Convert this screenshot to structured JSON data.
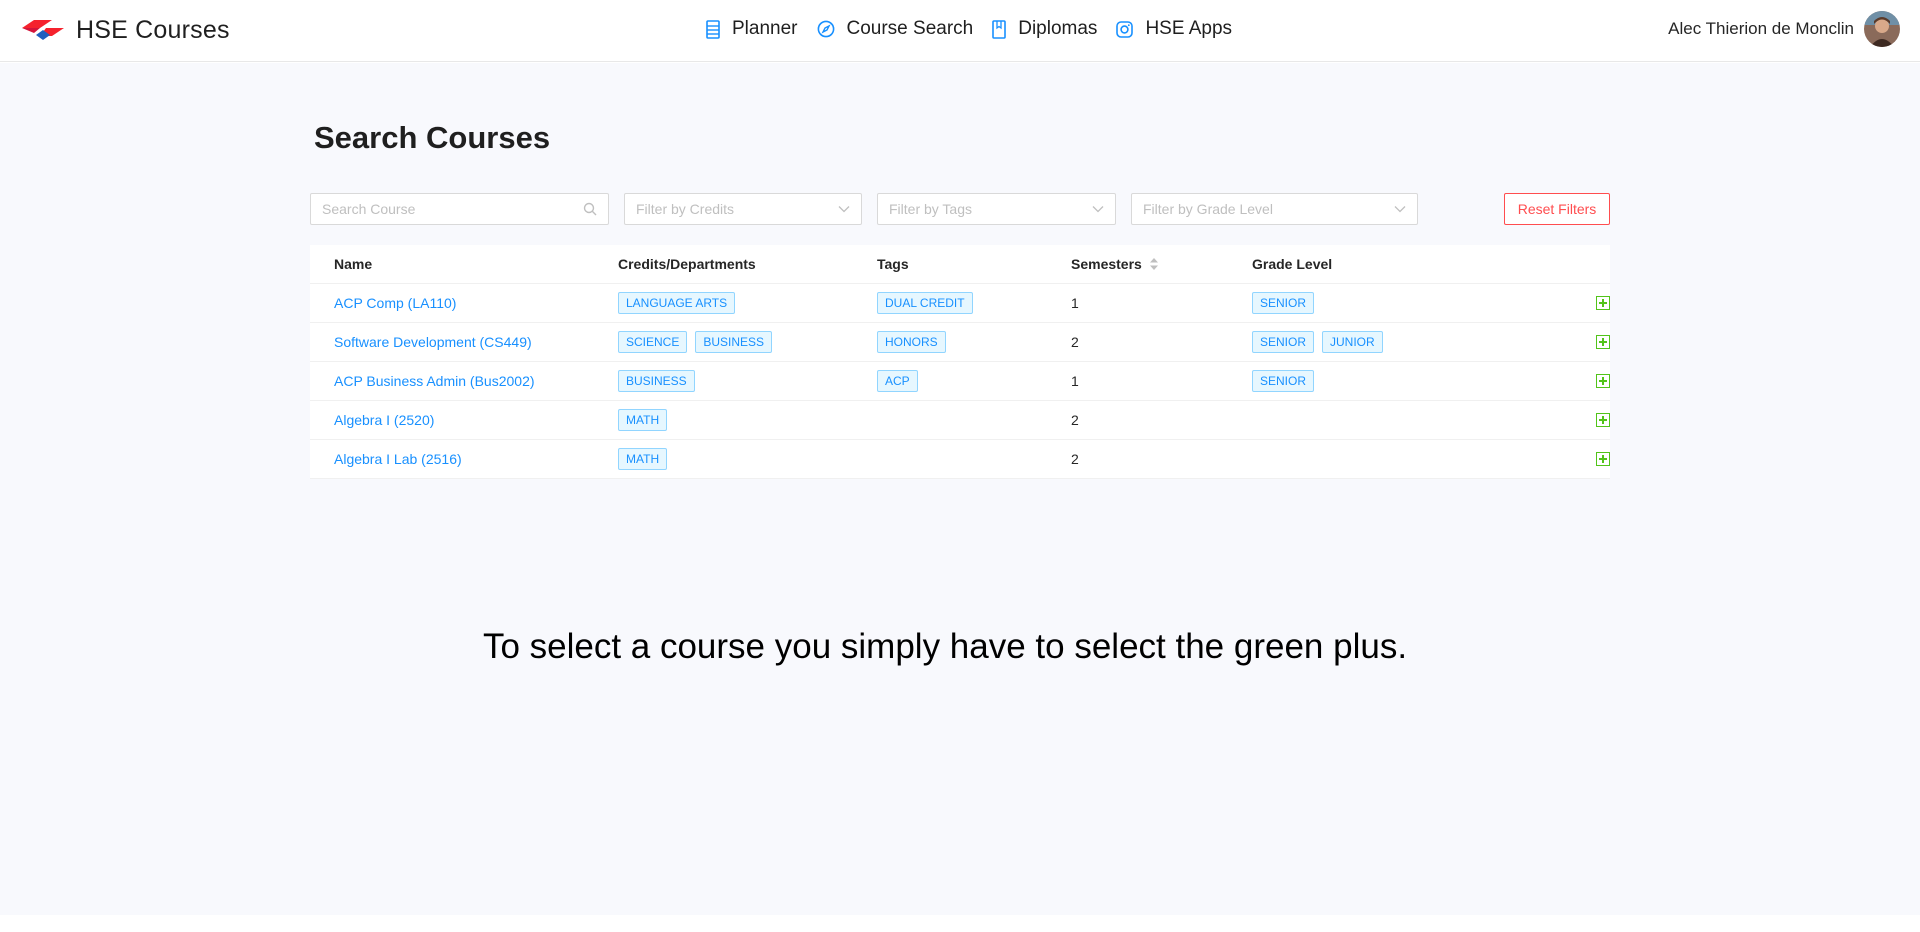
{
  "header": {
    "app_title": "HSE Courses",
    "nav": [
      {
        "label": "Planner",
        "icon": "planner-icon"
      },
      {
        "label": "Course Search",
        "icon": "compass-icon"
      },
      {
        "label": "Diplomas",
        "icon": "book-icon"
      },
      {
        "label": "HSE Apps",
        "icon": "instagram-icon"
      }
    ],
    "user_name": "Alec Thierion de Monclin"
  },
  "page": {
    "title": "Search Courses"
  },
  "filters": {
    "search_placeholder": "Search Course",
    "credits_placeholder": "Filter by Credits",
    "tags_placeholder": "Filter by Tags",
    "grade_placeholder": "Filter by Grade Level",
    "reset_label": "Reset Filters"
  },
  "table": {
    "columns": [
      "Name",
      "Credits/Departments",
      "Tags",
      "Semesters",
      "Grade Level"
    ],
    "rows": [
      {
        "name": "ACP Comp (LA110)",
        "departments": [
          "LANGUAGE ARTS"
        ],
        "tags": [
          "DUAL CREDIT"
        ],
        "semesters": "1",
        "grades": [
          "SENIOR"
        ]
      },
      {
        "name": "Software Development (CS449)",
        "departments": [
          "SCIENCE",
          "BUSINESS"
        ],
        "tags": [
          "HONORS"
        ],
        "semesters": "2",
        "grades": [
          "SENIOR",
          "JUNIOR"
        ]
      },
      {
        "name": "ACP Business Admin (Bus2002)",
        "departments": [
          "BUSINESS"
        ],
        "tags": [
          "ACP"
        ],
        "semesters": "1",
        "grades": [
          "SENIOR"
        ]
      },
      {
        "name": "Algebra I (2520)",
        "departments": [
          "MATH"
        ],
        "tags": [],
        "semesters": "2",
        "grades": []
      },
      {
        "name": "Algebra I Lab (2516)",
        "departments": [
          "MATH"
        ],
        "tags": [],
        "semesters": "2",
        "grades": []
      }
    ]
  },
  "instruction": "To select a course you simply have to select the green plus.",
  "colors": {
    "brand_red": "#f5222d",
    "brand_blue": "#1f5fbf",
    "link": "#1890ff",
    "add_green": "#52c41a",
    "reset_red": "#ff4d4f"
  }
}
